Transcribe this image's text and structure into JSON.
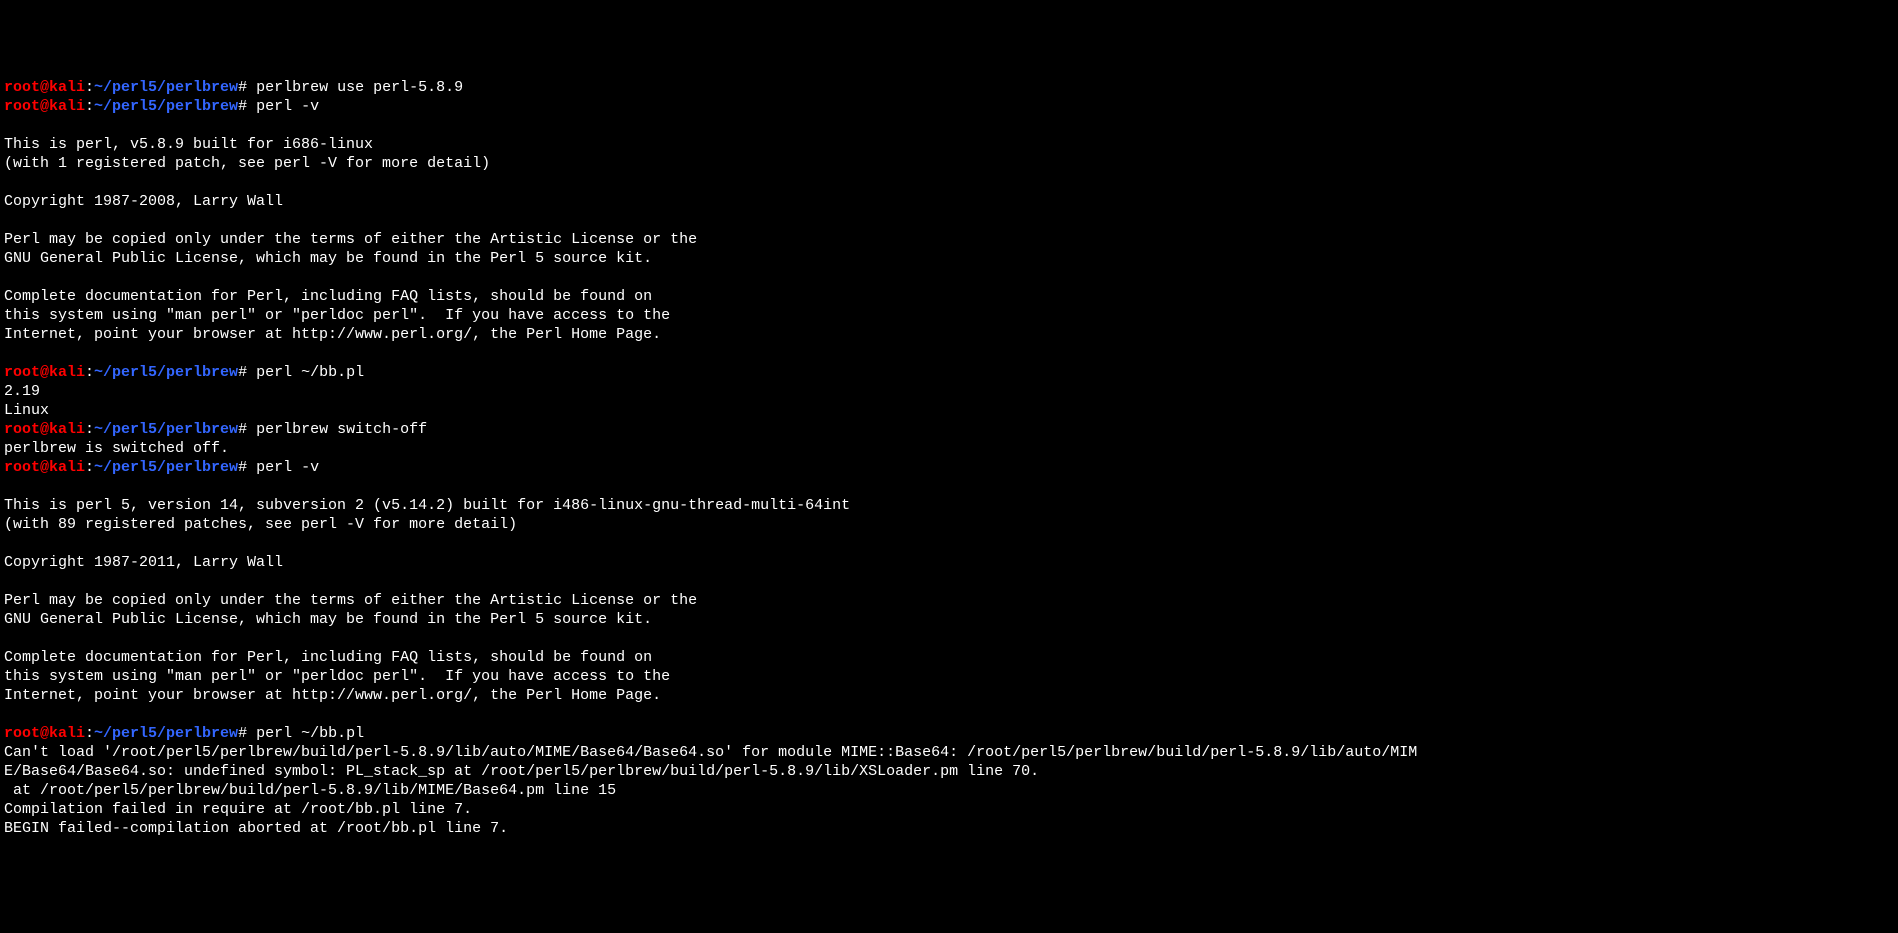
{
  "colors": {
    "background": "#000000",
    "foreground": "#ffffff",
    "prompt_user": "#ff0000",
    "prompt_path": "#3366ff"
  },
  "prompt": {
    "user": "root@kali",
    "colon": ":",
    "path": "~/perl5/perlbrew",
    "hash": "# "
  },
  "lines": [
    {
      "type": "prompt",
      "command": "perlbrew use perl-5.8.9"
    },
    {
      "type": "prompt",
      "command": "perl -v"
    },
    {
      "type": "blank"
    },
    {
      "type": "output",
      "text": "This is perl, v5.8.9 built for i686-linux"
    },
    {
      "type": "output",
      "text": "(with 1 registered patch, see perl -V for more detail)"
    },
    {
      "type": "blank"
    },
    {
      "type": "output",
      "text": "Copyright 1987-2008, Larry Wall"
    },
    {
      "type": "blank"
    },
    {
      "type": "output",
      "text": "Perl may be copied only under the terms of either the Artistic License or the"
    },
    {
      "type": "output",
      "text": "GNU General Public License, which may be found in the Perl 5 source kit."
    },
    {
      "type": "blank"
    },
    {
      "type": "output",
      "text": "Complete documentation for Perl, including FAQ lists, should be found on"
    },
    {
      "type": "output",
      "text": "this system using \"man perl\" or \"perldoc perl\".  If you have access to the"
    },
    {
      "type": "output",
      "text": "Internet, point your browser at http://www.perl.org/, the Perl Home Page."
    },
    {
      "type": "blank"
    },
    {
      "type": "prompt",
      "command": "perl ~/bb.pl"
    },
    {
      "type": "output",
      "text": "2.19"
    },
    {
      "type": "output",
      "text": "Linux"
    },
    {
      "type": "prompt",
      "command": "perlbrew switch-off"
    },
    {
      "type": "output",
      "text": "perlbrew is switched off."
    },
    {
      "type": "prompt",
      "command": "perl -v"
    },
    {
      "type": "blank"
    },
    {
      "type": "output",
      "text": "This is perl 5, version 14, subversion 2 (v5.14.2) built for i486-linux-gnu-thread-multi-64int"
    },
    {
      "type": "output",
      "text": "(with 89 registered patches, see perl -V for more detail)"
    },
    {
      "type": "blank"
    },
    {
      "type": "output",
      "text": "Copyright 1987-2011, Larry Wall"
    },
    {
      "type": "blank"
    },
    {
      "type": "output",
      "text": "Perl may be copied only under the terms of either the Artistic License or the"
    },
    {
      "type": "output",
      "text": "GNU General Public License, which may be found in the Perl 5 source kit."
    },
    {
      "type": "blank"
    },
    {
      "type": "output",
      "text": "Complete documentation for Perl, including FAQ lists, should be found on"
    },
    {
      "type": "output",
      "text": "this system using \"man perl\" or \"perldoc perl\".  If you have access to the"
    },
    {
      "type": "output",
      "text": "Internet, point your browser at http://www.perl.org/, the Perl Home Page."
    },
    {
      "type": "blank"
    },
    {
      "type": "prompt",
      "command": "perl ~/bb.pl"
    },
    {
      "type": "output",
      "text": "Can't load '/root/perl5/perlbrew/build/perl-5.8.9/lib/auto/MIME/Base64/Base64.so' for module MIME::Base64: /root/perl5/perlbrew/build/perl-5.8.9/lib/auto/MIM"
    },
    {
      "type": "output",
      "text": "E/Base64/Base64.so: undefined symbol: PL_stack_sp at /root/perl5/perlbrew/build/perl-5.8.9/lib/XSLoader.pm line 70."
    },
    {
      "type": "output",
      "text": " at /root/perl5/perlbrew/build/perl-5.8.9/lib/MIME/Base64.pm line 15"
    },
    {
      "type": "output",
      "text": "Compilation failed in require at /root/bb.pl line 7."
    },
    {
      "type": "output",
      "text": "BEGIN failed--compilation aborted at /root/bb.pl line 7."
    }
  ]
}
